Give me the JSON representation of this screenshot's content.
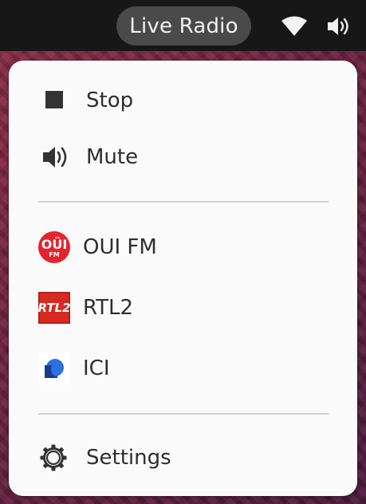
{
  "topbar": {
    "indicator_label": "Live Radio",
    "network_icon": "wifi-icon",
    "sound_icon": "speaker-icon"
  },
  "menu": {
    "controls": [
      {
        "label": "Stop",
        "icon": "stop-icon"
      },
      {
        "label": "Mute",
        "icon": "speaker-icon"
      }
    ],
    "stations": [
      {
        "label": "OUI FM",
        "logo_text": "OÜI",
        "logo_subtext": "FM",
        "color": "#e4232e"
      },
      {
        "label": "RTL2",
        "logo_text": "RTL2",
        "color": "#d62a22"
      },
      {
        "label": "ICI",
        "logo_colors": [
          "#1b3a8f",
          "#2f6fe0"
        ]
      }
    ],
    "settings": {
      "label": "Settings",
      "icon": "gear-icon"
    }
  },
  "colors": {
    "topbar": "#171717",
    "pill": "#4a4a4a",
    "menu_background": "#fafafa",
    "text": "#2e2e2e",
    "separator": "#d2d2d2"
  }
}
